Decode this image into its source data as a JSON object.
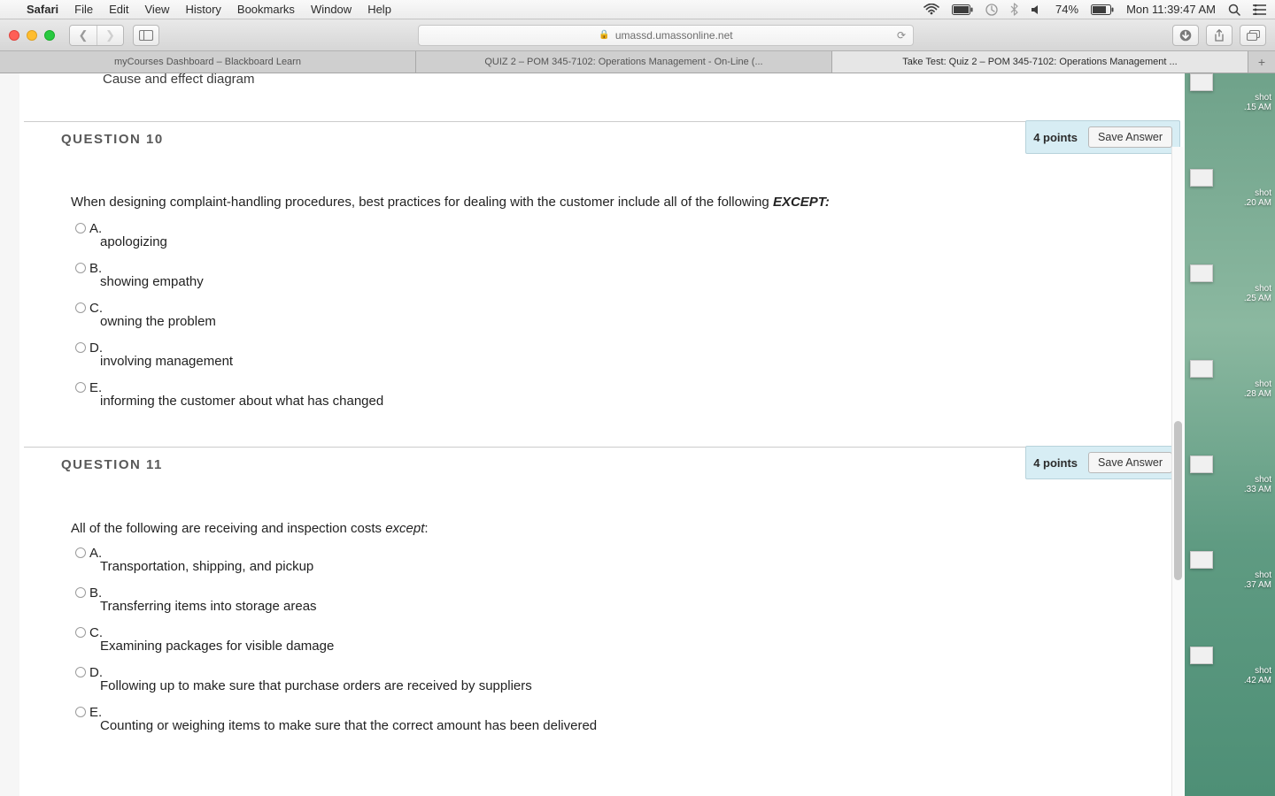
{
  "menubar": {
    "app": "Safari",
    "items": [
      "File",
      "Edit",
      "View",
      "History",
      "Bookmarks",
      "Window",
      "Help"
    ],
    "battery_pct": "74%",
    "clock": "Mon 11:39:47 AM"
  },
  "toolbar": {
    "url_host": "umassd.umassonline.net"
  },
  "tabs": [
    "myCourses Dashboard – Blackboard Learn",
    "QUIZ 2 – POM 345-7102: Operations Management - On-Line (...",
    "Take Test: Quiz 2 – POM 345-7102: Operations Management ..."
  ],
  "cut_line": "Cause and effect diagram",
  "q10": {
    "title": "QUESTION 10",
    "points": "4 points",
    "save": "Save Answer",
    "prompt_plain": "When designing complaint-handling procedures, best practices for dealing with the customer include all of the following ",
    "prompt_em": "EXCEPT:",
    "opts": {
      "A": {
        "letter": "A.",
        "text": "apologizing"
      },
      "B": {
        "letter": "B.",
        "text": "showing empathy"
      },
      "C": {
        "letter": "C.",
        "text": "owning the problem"
      },
      "D": {
        "letter": "D.",
        "text": "involving management"
      },
      "E": {
        "letter": "E.",
        "text": "informing the customer about what has changed"
      }
    }
  },
  "q11": {
    "title": "QUESTION 11",
    "points": "4 points",
    "save": "Save Answer",
    "prompt_plain": "All of the following are receiving and inspection costs ",
    "prompt_em": "except",
    "prompt_tail": ":",
    "opts": {
      "A": {
        "letter": "A.",
        "text": "Transportation, shipping, and pickup"
      },
      "B": {
        "letter": "B.",
        "text": "Transferring items into storage areas"
      },
      "C": {
        "letter": "C.",
        "text": "Examining packages for visible damage"
      },
      "D": {
        "letter": "D.",
        "text": "Following up to make sure that purchase orders are received by suppliers"
      },
      "E": {
        "letter": "E.",
        "text": "Counting or weighing items to make sure that the correct amount has been delivered"
      }
    }
  },
  "sshots": [
    {
      "l1": "shot",
      "l2": ".15 AM"
    },
    {
      "l1": "shot",
      "l2": ".20 AM"
    },
    {
      "l1": "shot",
      "l2": ".25 AM"
    },
    {
      "l1": "shot",
      "l2": ".28 AM"
    },
    {
      "l1": "shot",
      "l2": ".33 AM"
    },
    {
      "l1": "shot",
      "l2": ".37 AM"
    },
    {
      "l1": "shot",
      "l2": ".42 AM"
    }
  ]
}
